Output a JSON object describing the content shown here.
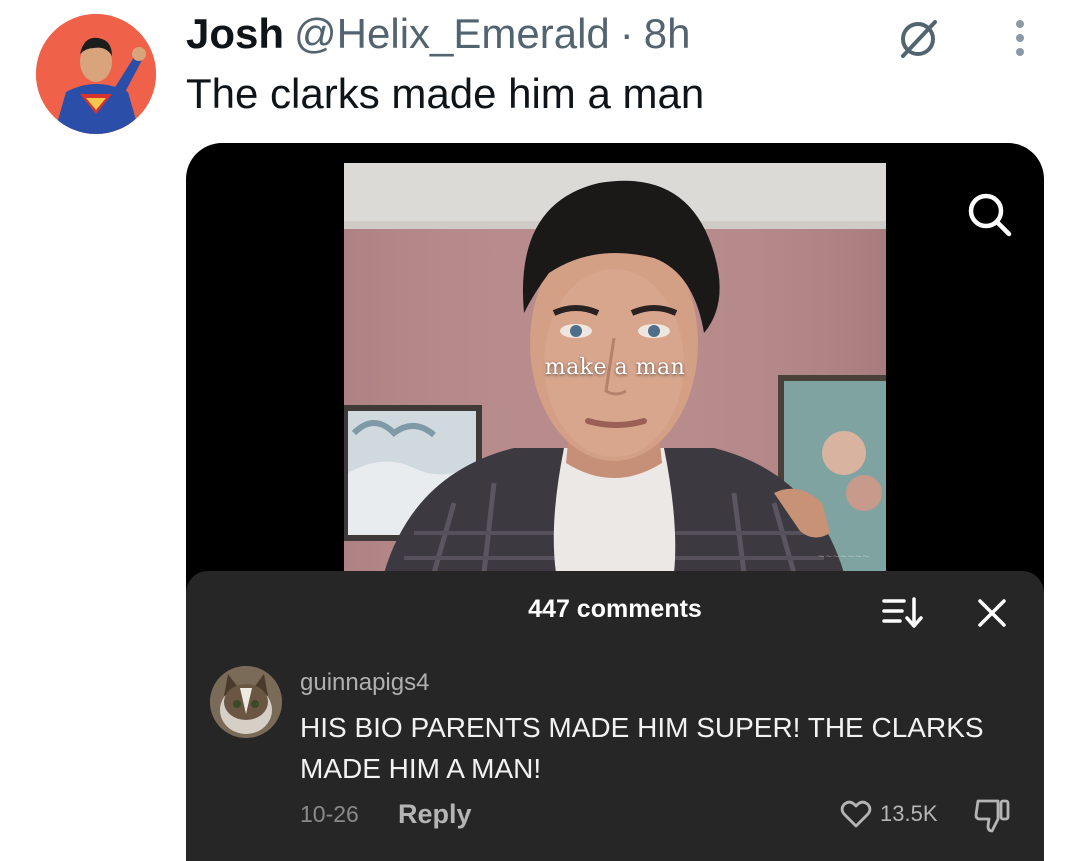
{
  "tweet": {
    "author_name": "Josh",
    "handle": "@Helix_Emerald",
    "separator": "·",
    "time": "8h",
    "text": "The clarks made him a man"
  },
  "icons": {
    "grok": "grok-slash-circle-icon",
    "more": "more-vertical-dots-icon",
    "search": "search-icon",
    "sort": "sort-icon",
    "close": "close-icon",
    "like": "heart-icon",
    "dislike": "thumbs-down-icon"
  },
  "media": {
    "overlay_caption": "make a man",
    "watermark": "~~~~~~~"
  },
  "comments": {
    "count_label": "447 comments",
    "items": [
      {
        "username": "guinnapigs4",
        "text": "HIS BIO PARENTS MADE HIM SUPER! THE CLARKS MADE HIM A MAN!",
        "date": "10-26",
        "reply_label": "Reply",
        "likes": "13.5K"
      }
    ]
  },
  "colors": {
    "handle_gray": "#536471",
    "avatar_bg": "#f0614a",
    "panel_bg": "#262626",
    "media_bg": "#000000"
  }
}
